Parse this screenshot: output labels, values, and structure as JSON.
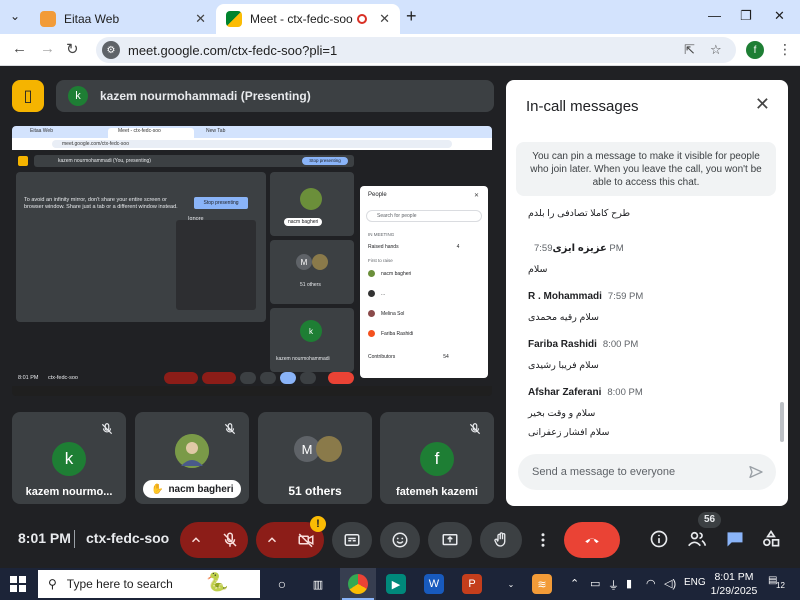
{
  "browser": {
    "tabs": [
      {
        "title": "Eitaa Web",
        "active": false
      },
      {
        "title": "Meet - ctx-fedc-soo",
        "active": true
      }
    ],
    "url": "meet.google.com/ctx-fedc-soo?pli=1",
    "profile_initial": "f"
  },
  "meet": {
    "presenter_initial": "k",
    "presenting_label": "kazem nourmohammadi (Presenting)",
    "shared_screen": {
      "tabs": [
        "Eitaa Web",
        "Meet - ctx-fedc-soo",
        "New Tab"
      ],
      "url": "meet.google.com/ctx-fedc-soo",
      "presenting_label": "kazem nourmohammadi (You, presenting)",
      "stop_presenting": "Stop presenting",
      "warning": "To avoid an infinity mirror, don't share your entire screen or browser window. Share just a tab or a different window instead.",
      "stop_presenting_2": "Stop presenting",
      "ignore": "Ignore",
      "tile_labels": [
        "nacm bagheri",
        "51 others",
        "kazem nourmohammadi"
      ],
      "people": {
        "title": "People",
        "search": "Search for people",
        "section": "IN MEETING",
        "raised_hands": "Raised hands",
        "raised_hands_count": "4",
        "first_to_raise": "First to raise",
        "names": [
          "nacm bagheri",
          "...",
          "Melina Sol",
          "Fariba Rashidi"
        ],
        "contributors": "Contributors",
        "contributors_count": "54"
      },
      "time": "8:01 PM",
      "code": "ctx-fedc-soo"
    },
    "tiles": [
      {
        "name": "kazem nourmo...",
        "initial": "k",
        "color": "#1e7e34"
      },
      {
        "name": "nacm bagheri",
        "initial": "",
        "color": "#6b8f3a"
      },
      {
        "name": "51 others",
        "initial": "M",
        "color": "#5f6368"
      },
      {
        "name": "fatemeh kazemi",
        "initial": "f",
        "color": "#1e7e34"
      }
    ],
    "chat": {
      "title": "In-call messages",
      "pin_note": "You can pin a message to make it visible for people who join later. When you leave the call, you won't be able to access this chat.",
      "messages": [
        {
          "sender": "",
          "time": "",
          "text": "طرح کاملا تصادفی را بلدم"
        },
        {
          "sender": "عزیزه ایزی",
          "time": "7:59 PM",
          "text": "سلام"
        },
        {
          "sender": "R . Mohammadi",
          "time": "7:59 PM",
          "text": "سلام رقیه محمدی"
        },
        {
          "sender": "Fariba Rashidi",
          "time": "8:00 PM",
          "text": "سلام فریبا رشیدی"
        },
        {
          "sender": "Afshar Zaferani",
          "time": "8:00 PM",
          "text": "سلام و وقت بخیر",
          "text2": "سلام افشار زعفرانی"
        }
      ],
      "input_placeholder": "Send a message to everyone"
    },
    "controls": {
      "time": "8:01 PM",
      "code": "ctx-fedc-soo",
      "warning_badge": "!",
      "people_count": "56"
    }
  },
  "taskbar": {
    "search_placeholder": "Type here to search",
    "language": "ENG",
    "time": "8:01 PM",
    "date": "1/29/2025",
    "notifications": "12"
  }
}
